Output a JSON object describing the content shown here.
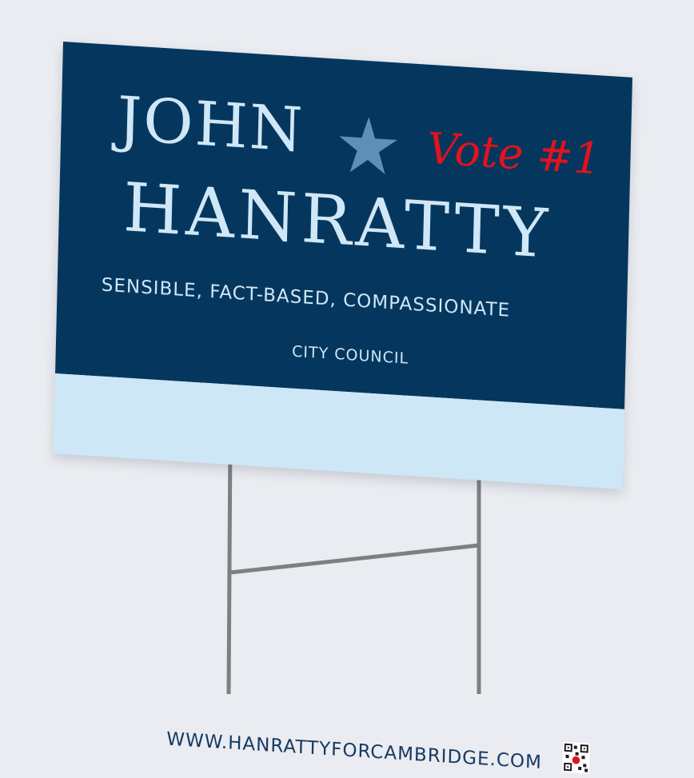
{
  "sign": {
    "first_name": "JOHN",
    "vote": "Vote #1",
    "last_name": "HANRATTY",
    "tagline": "SENSIBLE, FACT-BASED, COMPASSIONATE",
    "office": "CITY COUNCIL",
    "website": "WWW.HANRATTYFORCAMBRIDGE.COM"
  },
  "colors": {
    "background": "#eaecf1",
    "panel": "#05375e",
    "text_light": "#cfe7f6",
    "vote_red": "#e3121c",
    "footer": "#cde7f6",
    "footer_text": "#173a62",
    "star": "#5f8fb8",
    "stake": "#7d7f83"
  },
  "icons": {
    "star": "star-icon",
    "qr": "qr-code-icon"
  }
}
